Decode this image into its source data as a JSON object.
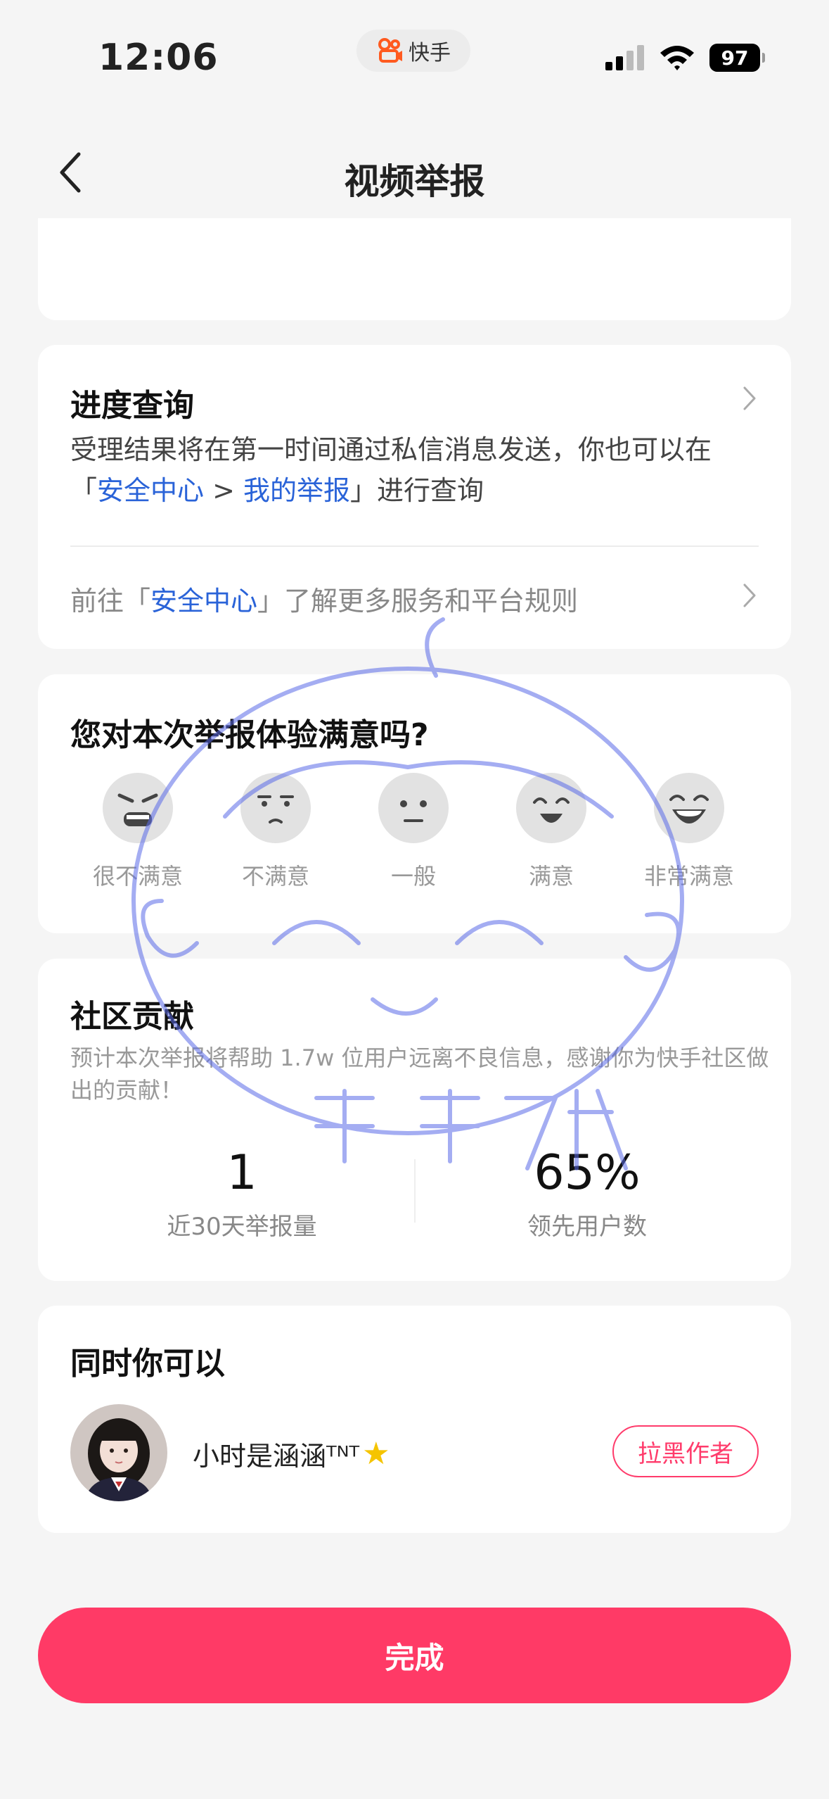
{
  "status_bar": {
    "time": "12:06",
    "app_pill_label": "快手",
    "battery": "97"
  },
  "nav": {
    "title": "视频举报"
  },
  "progress": {
    "title": "进度查询",
    "desc_part1": "受理结果将在第一时间通过私信消息发送，你也可以在「",
    "link1": "安全中心",
    "sep": " > ",
    "link2": "我的举报",
    "desc_part2": "」进行查询",
    "goto_prefix": "前往「",
    "goto_link": "安全中心",
    "goto_suffix": "」了解更多服务和平台规则"
  },
  "satisfaction": {
    "title": "您对本次举报体验满意吗?",
    "options": [
      "很不满意",
      "不满意",
      "一般",
      "满意",
      "非常满意"
    ]
  },
  "contribution": {
    "title": "社区贡献",
    "desc": "预计本次举报将帮助 1.7w 位用户远离不良信息，感谢你为快手社区做出的贡献！",
    "stat1_value": "1",
    "stat1_label": "近30天举报量",
    "stat2_value": "65%",
    "stat2_label": "领先用户数"
  },
  "also": {
    "title": "同时你可以",
    "username": "小时是涵涵ᵀᴺᵀ",
    "block_label": "拉黑作者"
  },
  "done_label": "完成",
  "colors": {
    "accent": "#ff3a66",
    "link": "#2a63d8"
  }
}
